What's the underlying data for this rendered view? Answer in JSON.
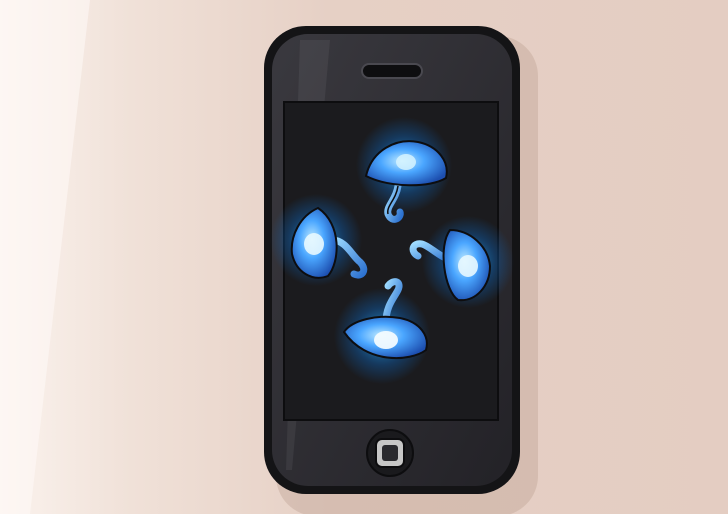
{
  "scene": {
    "colors": {
      "wall_base": "#e7d2c8",
      "wall_light": "#f7ece6",
      "phone_body": "#1f1f22",
      "phone_bezel": "#2c2b30",
      "screen": "#1b1b1e",
      "glow": "#1ea8ff",
      "mushroom_cap": "#3a78d6",
      "mushroom_light": "#7fd0ff",
      "speaker": "#141416",
      "home_button_ring": "#bdbdbd",
      "home_button_center": "#2a2a2a"
    },
    "icons": {
      "phone": "smartphone-icon",
      "speaker": "speaker-slot-icon",
      "home_button": "home-button-icon",
      "wallpaper": "glowing-mushrooms-wallpaper"
    }
  }
}
